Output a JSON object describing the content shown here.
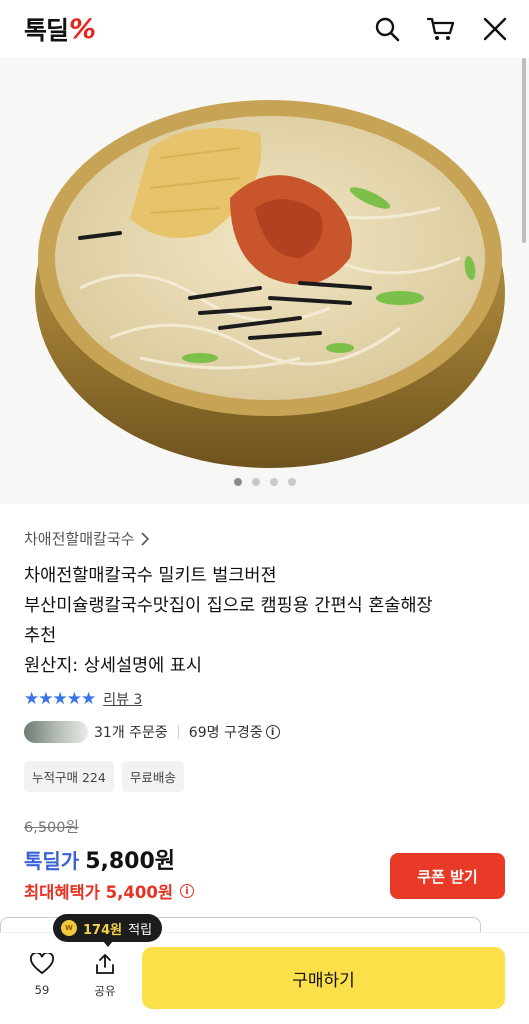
{
  "header": {
    "logo_text": "톡딜",
    "logo_mark": "%",
    "icons": [
      "search-icon",
      "cart-icon",
      "close-icon"
    ]
  },
  "gallery": {
    "image_subject": "bowl of kalguksu noodle soup",
    "slide_count": 4,
    "active_index": 0
  },
  "product": {
    "store_breadcrumb": "차애전할매칼국수",
    "title_lines": [
      "차애전할매칼국수 밀키트 벌크버젼",
      "부산미슐랭칼국수맛집이 집으로 캠핑용 간편식 혼술해장",
      "추천",
      "원산지: 상세설명에 표시"
    ],
    "rating_stars": "★★★★★",
    "rating_value": 5,
    "review_link": "리뷰 3",
    "orders_text": "31개 주문중",
    "viewers_text": "69명 구경중",
    "info_mark": "i",
    "tags": [
      "누적구매 224",
      "무료배송"
    ]
  },
  "pricing": {
    "original_price": "6,500원",
    "deal_label": "톡딜가",
    "deal_price": "5,800원",
    "max_benefit_text": "최대혜택가 5,400원",
    "coupon_button": "쿠폰 받기"
  },
  "bottom_bar": {
    "reward_coin": "W",
    "reward_amount": "174원",
    "reward_suffix": "적립",
    "like_count": "59",
    "share_label": "공유",
    "buy_button": "구매하기"
  },
  "colors": {
    "brand_red": "#e8241f",
    "price_blue": "#3a62d8",
    "benefit_red": "#e53322",
    "buy_yellow": "#fbe04a",
    "star_blue": "#3a74e8"
  }
}
